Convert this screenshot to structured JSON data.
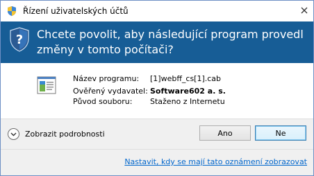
{
  "window": {
    "title": "Řízení uživatelských účtů"
  },
  "banner": {
    "question": "Chcete povolit, aby následující program provedl změny v tomto počítači?"
  },
  "program_info": {
    "rows": [
      {
        "label": "Název programu:",
        "value": "[1]webff_cs[1].cab",
        "bold": false
      },
      {
        "label": "Ověřený vydavatel:",
        "value": "Software602 a. s.",
        "bold": true
      },
      {
        "label": "Původ souboru:",
        "value": "Staženo z Internetu",
        "bold": false
      }
    ]
  },
  "footer": {
    "details_label": "Zobrazit podrobnosti",
    "yes_label": "Ano",
    "no_label": "Ne",
    "notify_link": "Nastavit, kdy se mají tato oznámení zobrazovat"
  },
  "colors": {
    "banner_bg": "#175d96",
    "link": "#0066cc",
    "footer_bg": "#f0f0f0"
  },
  "icons": {
    "title": "uac-shield-icon",
    "banner": "uac-shield-icon",
    "close": "close-icon",
    "program": "program-file-icon",
    "details": "chevron-down-icon"
  }
}
